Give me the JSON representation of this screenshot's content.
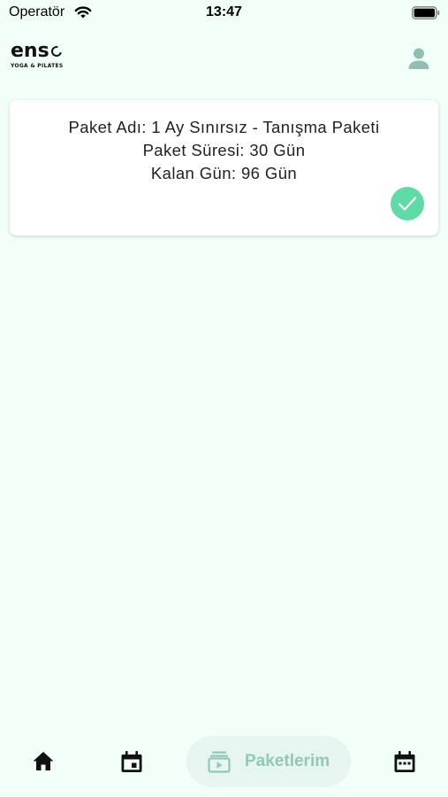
{
  "status_bar": {
    "carrier": "Operatör",
    "time": "13:47"
  },
  "header": {
    "logo_text": "ens",
    "logo_subtitle": "YOGA & PILATES"
  },
  "package": {
    "line_name": "Paket Adı: 1 Ay Sınırsız - Tanışma Paketi",
    "line_duration": "Paket Süresi: 30 Gün",
    "line_remaining": "Kalan Gün: 96 Gün",
    "active": true
  },
  "bottom_nav": {
    "active_label": "Paketlerim",
    "items": [
      {
        "icon": "home-icon"
      },
      {
        "icon": "calendar-event-icon"
      },
      {
        "icon": "packages-icon",
        "label": "Paketlerim"
      },
      {
        "icon": "calendar-month-icon"
      }
    ]
  },
  "colors": {
    "background": "#f2fff9",
    "accent_green": "#5fdca6",
    "profile_icon": "#8fbfb2",
    "active_tab_bg": "#e6f5ef",
    "active_tab_text": "#8fc9b8"
  }
}
